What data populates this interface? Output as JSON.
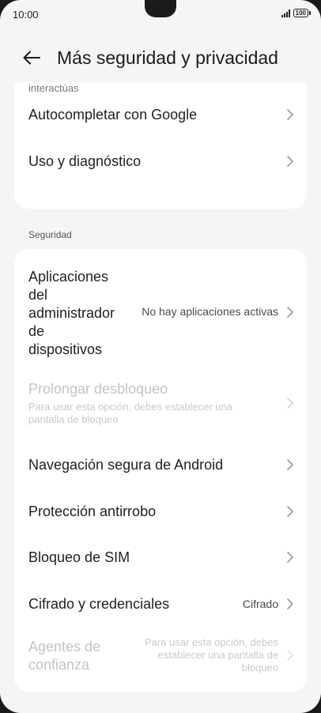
{
  "status": {
    "time": "10:00",
    "battery": "100"
  },
  "header": {
    "title": "Más seguridad y privacidad"
  },
  "card1": {
    "cut_desc": "interactúas",
    "items": [
      {
        "label": "Autocompletar con Google"
      },
      {
        "label": "Uso y diagnóstico"
      }
    ]
  },
  "section": {
    "label": "Seguridad"
  },
  "card2": {
    "admin": {
      "label_lines": [
        "Aplicaciones",
        "del",
        "administrador",
        "de",
        "dispositivos"
      ],
      "value": "No hay aplicaciones activas"
    },
    "prolong": {
      "label": "Prolongar desbloqueo",
      "sub_lines": [
        "Para usar esta opción, debes establecer una",
        "pantalla de bloqueo"
      ]
    },
    "items": [
      {
        "label": "Navegación segura de Android"
      },
      {
        "label": "Protección antirrobo"
      },
      {
        "label": "Bloqueo de SIM"
      }
    ],
    "cipher": {
      "label": "Cifrado y credenciales",
      "value": "Cifrado"
    },
    "trust": {
      "label_lines": [
        "Agentes de",
        "confianza"
      ],
      "side_lines": [
        "Para usar esta opción, debes",
        "establecer una pantalla de",
        "bloqueo"
      ]
    }
  }
}
